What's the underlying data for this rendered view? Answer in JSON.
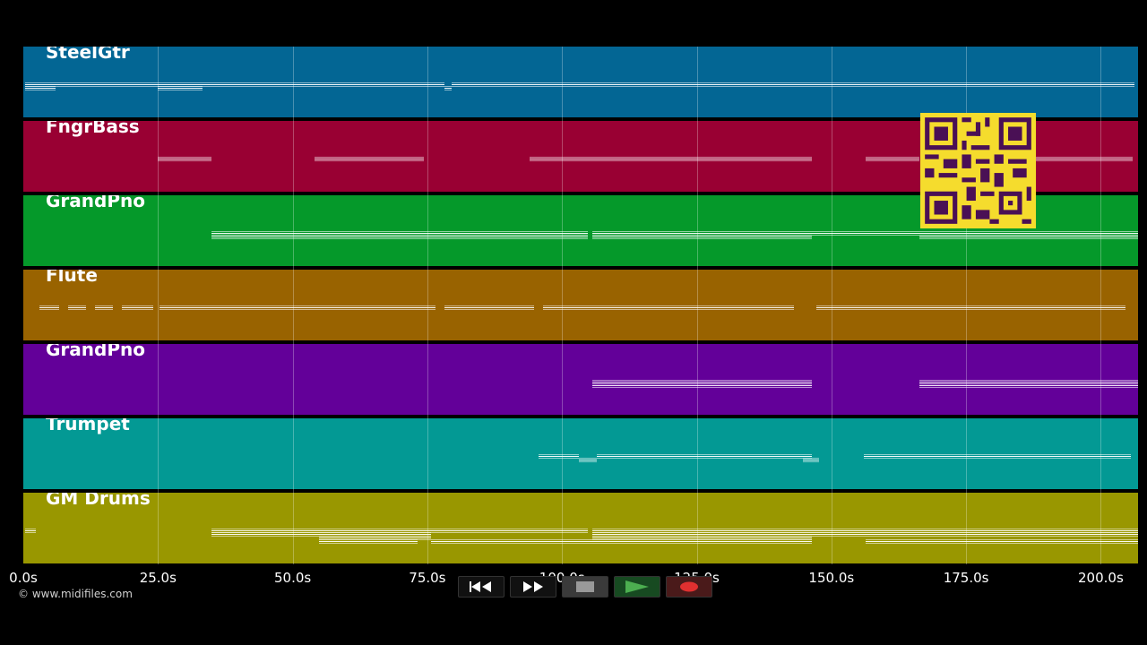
{
  "tracks": [
    {
      "name": "SteelGtr",
      "color": "#036694",
      "notes": [
        [
          2,
          36,
          1
        ],
        [
          2,
          36,
          2
        ],
        [
          36,
          150,
          1
        ],
        [
          150,
          200,
          1
        ],
        [
          150,
          200,
          2
        ],
        [
          200,
          245,
          1
        ],
        [
          245,
          400,
          1
        ],
        [
          400,
          470,
          1
        ],
        [
          470,
          478,
          2
        ],
        [
          478,
          700,
          1
        ],
        [
          700,
          880,
          1
        ],
        [
          880,
          1000,
          1
        ],
        [
          1000,
          1240,
          1
        ]
      ]
    },
    {
      "name": "FngrBass",
      "color": "#990033",
      "notes": [
        [
          150,
          160,
          1
        ],
        [
          160,
          210,
          1
        ],
        [
          325,
          447,
          1
        ],
        [
          565,
          700,
          1
        ],
        [
          700,
          880,
          1
        ],
        [
          940,
          1000,
          1
        ],
        [
          1120,
          1238,
          1
        ]
      ]
    },
    {
      "name": "GrandPno",
      "color": "#05992a",
      "notes": [
        [
          210,
          450,
          1
        ],
        [
          210,
          450,
          2
        ],
        [
          450,
          630,
          1
        ],
        [
          450,
          630,
          2
        ],
        [
          635,
          880,
          1
        ],
        [
          635,
          880,
          2
        ],
        [
          880,
          1000,
          1
        ],
        [
          1000,
          1244,
          1
        ],
        [
          1000,
          1244,
          2
        ]
      ]
    },
    {
      "name": "Flute",
      "color": "#996300",
      "notes": [
        [
          18,
          40,
          1
        ],
        [
          50,
          70,
          1
        ],
        [
          80,
          100,
          1
        ],
        [
          110,
          145,
          1
        ],
        [
          152,
          240,
          1
        ],
        [
          240,
          320,
          1
        ],
        [
          320,
          460,
          1
        ],
        [
          470,
          570,
          1
        ],
        [
          580,
          650,
          1
        ],
        [
          650,
          860,
          1
        ],
        [
          885,
          1000,
          1
        ],
        [
          1000,
          1230,
          1
        ]
      ]
    },
    {
      "name": "GrandPno",
      "color": "#630099",
      "notes": [
        [
          635,
          880,
          1
        ],
        [
          635,
          880,
          2
        ],
        [
          1000,
          1244,
          1
        ],
        [
          1000,
          1244,
          2
        ]
      ]
    },
    {
      "name": "Trumpet",
      "color": "#039994",
      "notes": [
        [
          575,
          620,
          1
        ],
        [
          620,
          640,
          2
        ],
        [
          640,
          740,
          1
        ],
        [
          740,
          880,
          1
        ],
        [
          870,
          888,
          2
        ],
        [
          938,
          1000,
          1
        ],
        [
          1000,
          1236,
          1
        ]
      ]
    },
    {
      "name": "GM Drums",
      "color": "#999700",
      "notes": [
        [
          2,
          14,
          1
        ],
        [
          210,
          455,
          1
        ],
        [
          210,
          455,
          2
        ],
        [
          330,
          455,
          3
        ],
        [
          455,
          630,
          1
        ],
        [
          330,
          440,
          4
        ],
        [
          455,
          880,
          4
        ],
        [
          635,
          880,
          1
        ],
        [
          635,
          880,
          2
        ],
        [
          635,
          880,
          3
        ],
        [
          880,
          1244,
          1
        ],
        [
          880,
          1244,
          2
        ],
        [
          940,
          1244,
          4
        ]
      ]
    }
  ],
  "time_axis": {
    "labels": [
      "0.0s",
      "25.0s",
      "50.0s",
      "75.0s",
      "100.0s",
      "125.0s",
      "150.0s",
      "175.0s",
      "200.0s"
    ],
    "max_seconds": 207
  },
  "credit": "© www.midifiles.com",
  "transport": {
    "rewind_icon": "rewind-icon",
    "forward_icon": "fast-forward-icon",
    "stop_icon": "stop-icon",
    "play_icon": "play-icon",
    "record_icon": "record-icon"
  },
  "colors": {
    "background": "#000000",
    "qr": "#f5dc2d"
  }
}
